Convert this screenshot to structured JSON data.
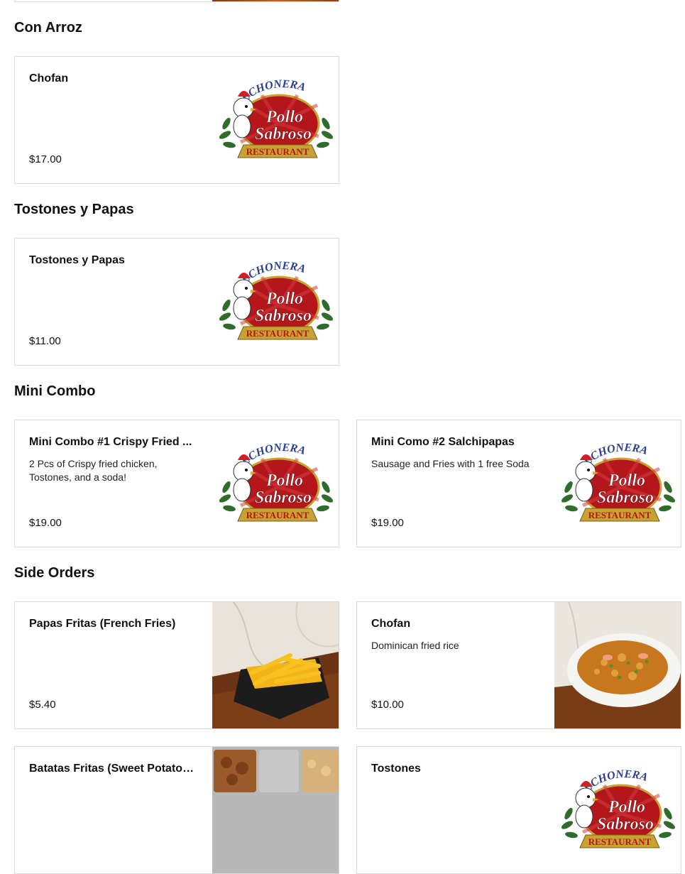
{
  "sections": [
    {
      "title": "Con Arroz",
      "items": [
        {
          "name": "Chofan",
          "description": "",
          "price": "$17.00",
          "image": "logo"
        }
      ]
    },
    {
      "title": "Tostones y Papas",
      "items": [
        {
          "name": "Tostones y Papas",
          "description": "",
          "price": "$11.00",
          "image": "logo"
        }
      ]
    },
    {
      "title": "Mini Combo",
      "items": [
        {
          "name": "Mini Combo #1 Crispy Fried ...",
          "description": "2 Pcs of Crispy fried chicken, Tostones, and a soda!",
          "price": "$19.00",
          "image": "logo"
        },
        {
          "name": "Mini Como #2 Salchipapas",
          "description": "Sausage and Fries with 1 free Soda",
          "price": "$19.00",
          "image": "logo"
        }
      ]
    },
    {
      "title": "Side Orders",
      "items": [
        {
          "name": "Papas Fritas (French Fries)",
          "description": "",
          "price": "$5.40",
          "image": "fries-photo"
        },
        {
          "name": "Chofan",
          "description": "Dominican fried rice",
          "price": "$10.00",
          "image": "fried-rice-photo"
        },
        {
          "name": "Batatas Fritas (Sweet Potatoes)",
          "description": "",
          "price": "",
          "image": "trays-photo"
        },
        {
          "name": "Tostones",
          "description": "",
          "price": "",
          "image": "logo"
        }
      ]
    }
  ],
  "logo_text": {
    "top": "LECHONERA",
    "line1": "Pollo",
    "line2": "Sabroso",
    "banner": "RESTAURANT"
  },
  "colors": {
    "logo_red": "#b3161b",
    "logo_blue": "#2a3f8f",
    "logo_gold": "#c8a232",
    "logo_green": "#2f6b2a"
  }
}
